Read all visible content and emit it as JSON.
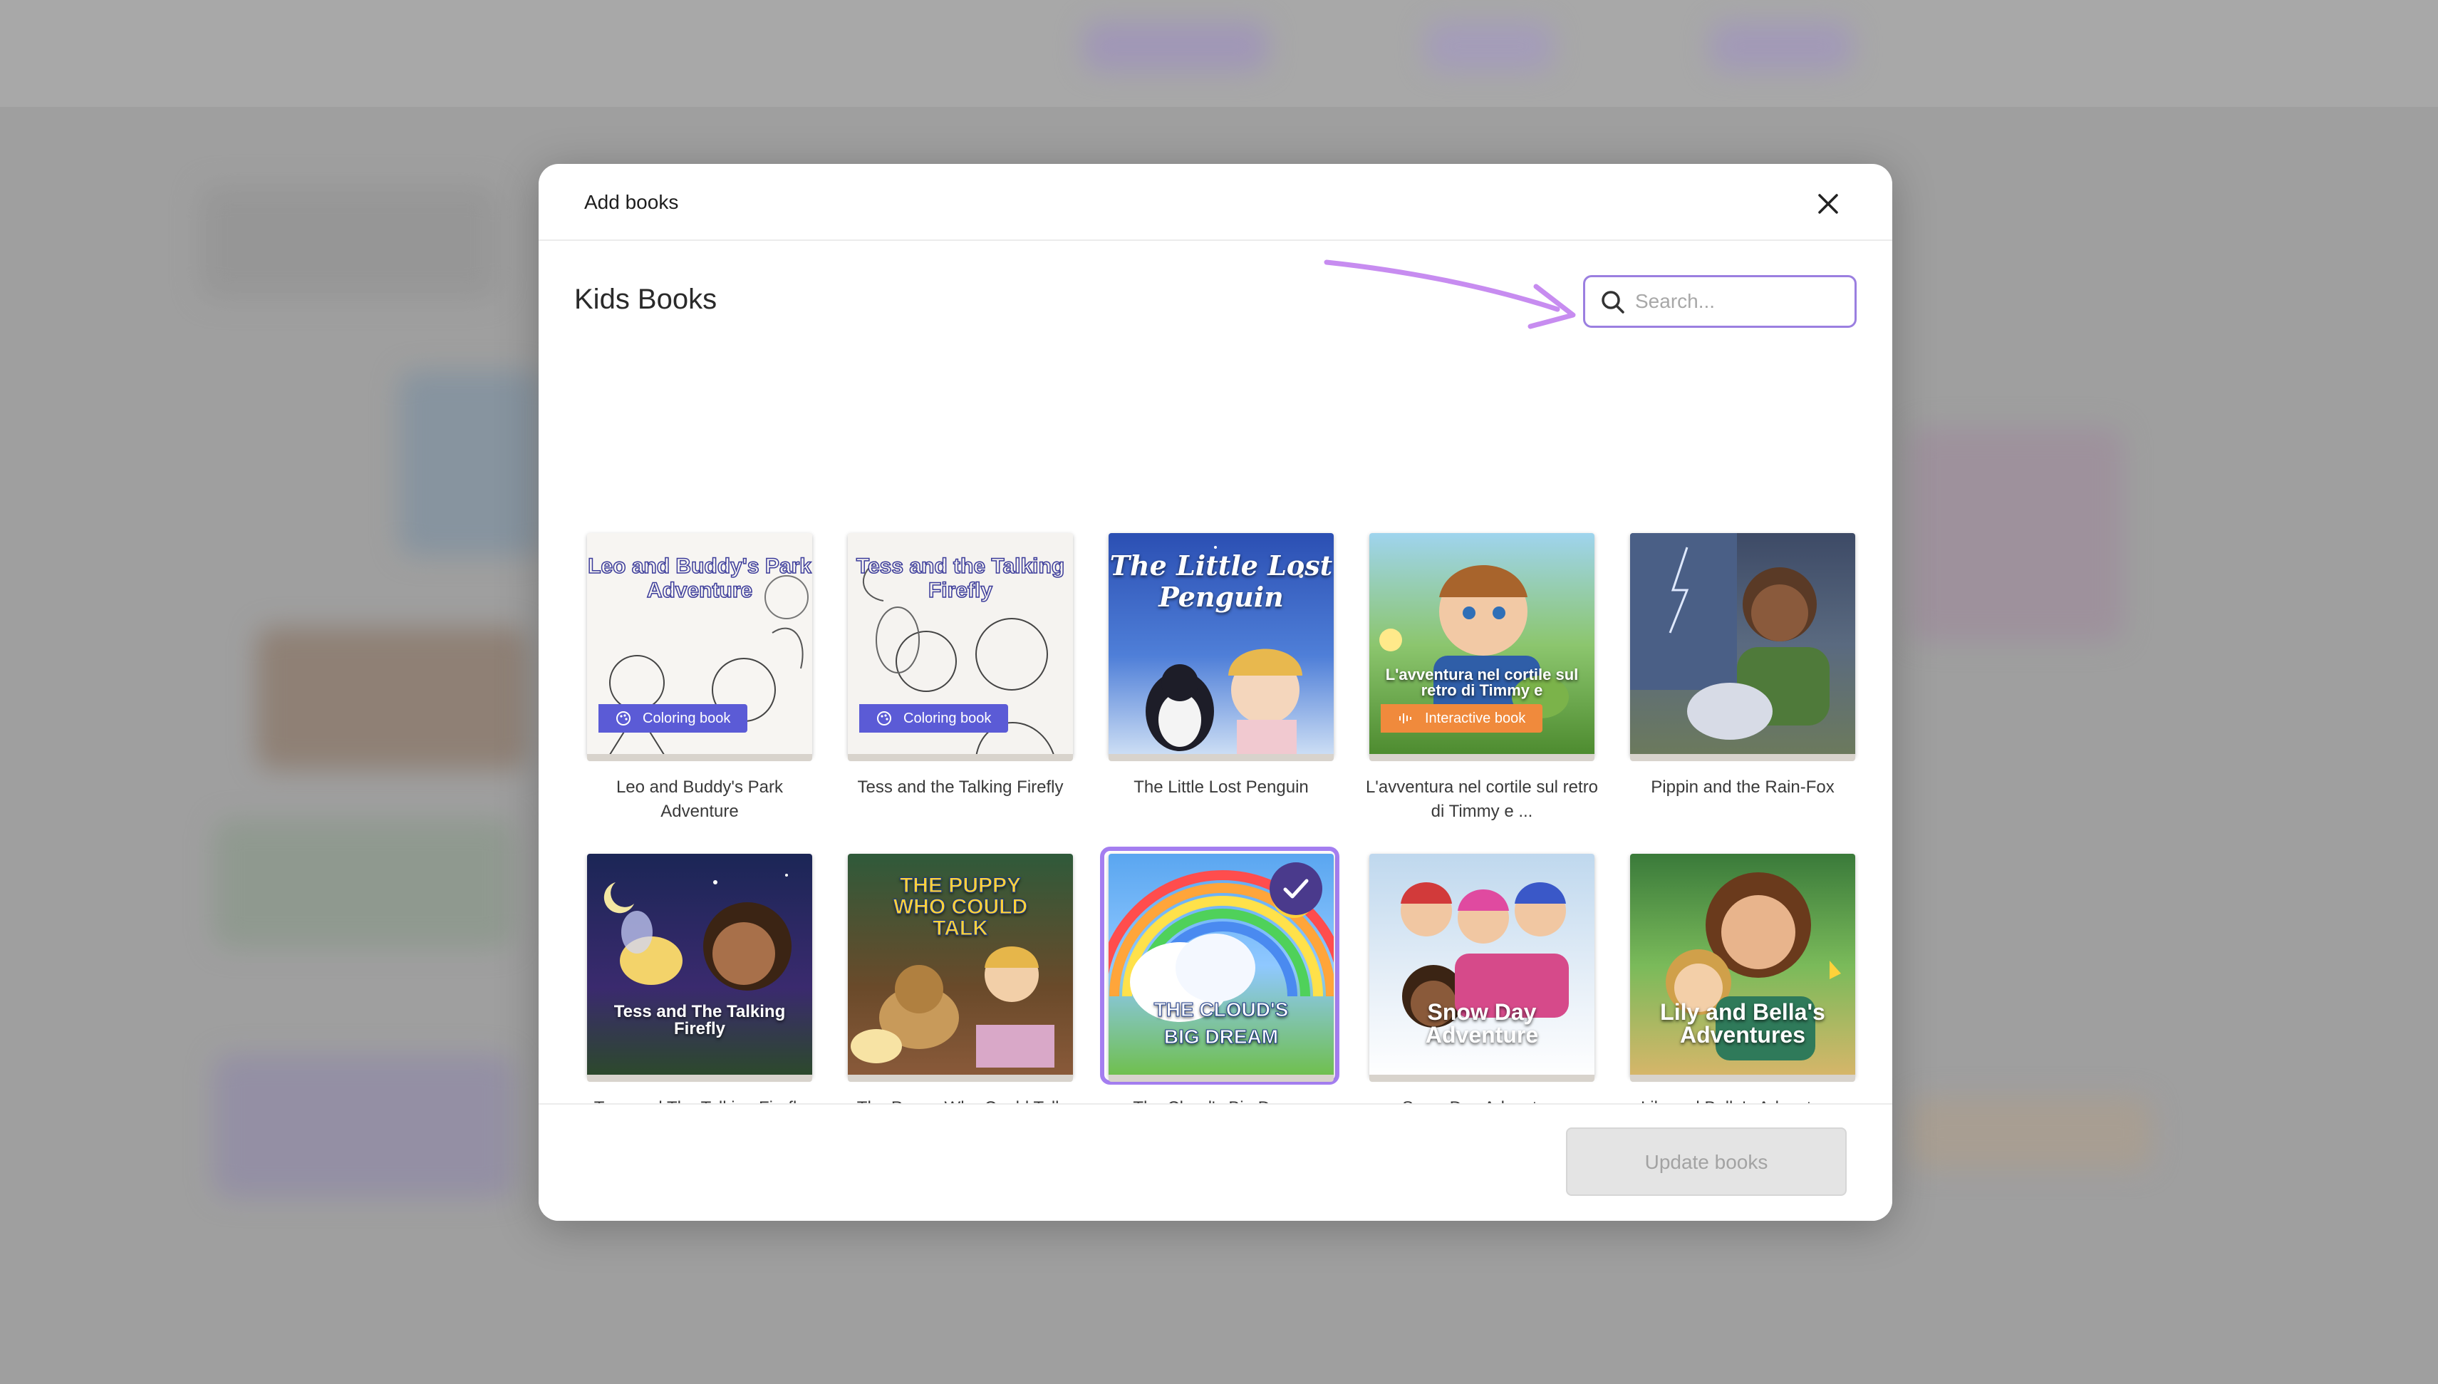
{
  "modal": {
    "title": "Add books",
    "section_title": "Kids Books",
    "search": {
      "placeholder": "Search...",
      "value": ""
    },
    "update_button": "Update books"
  },
  "books": [
    {
      "title": "Leo and Buddy's Park Adventure",
      "badge": "Coloring book",
      "cover_text": "Leo and Buddy's Park Adventure"
    },
    {
      "title": "Tess and the Talking Firefly",
      "badge": "Coloring book",
      "cover_text": "Tess and the Talking Firefly"
    },
    {
      "title": "The Little Lost Penguin",
      "cover_text": "The Little Lost Penguin"
    },
    {
      "title": "L'avventura nel cortile sul retro di Timmy e ...",
      "badge": "Interactive book",
      "cover_text": "L'avventura nel cortile sul retro di Timmy e"
    },
    {
      "title": "Pippin and the Rain-Fox"
    },
    {
      "title": "Tess and The Talking Firefly",
      "cover_text": "Tess and The Talking Firefly"
    },
    {
      "title": "The Puppy Who Could Talk",
      "cover_text": "THE PUPPY WHO COULD TALK"
    },
    {
      "title": "The Cloud's Big Dream",
      "cover_text": "THE CLOUD'S BIG DREAM",
      "selected": true
    },
    {
      "title": "Snow Day Adventure",
      "cover_text": "Snow Day Adventure"
    },
    {
      "title": "Lily and Bella's Adventures",
      "cover_text": "Lily and Bella's Adventures"
    }
  ],
  "colors": {
    "accent": "#a47ef0",
    "coloring_badge": "#5b5bd6",
    "interactive_badge": "#f08a3c"
  },
  "icons": [
    "close-icon",
    "search-icon",
    "palette-icon",
    "audio-wave-icon",
    "check-icon"
  ]
}
